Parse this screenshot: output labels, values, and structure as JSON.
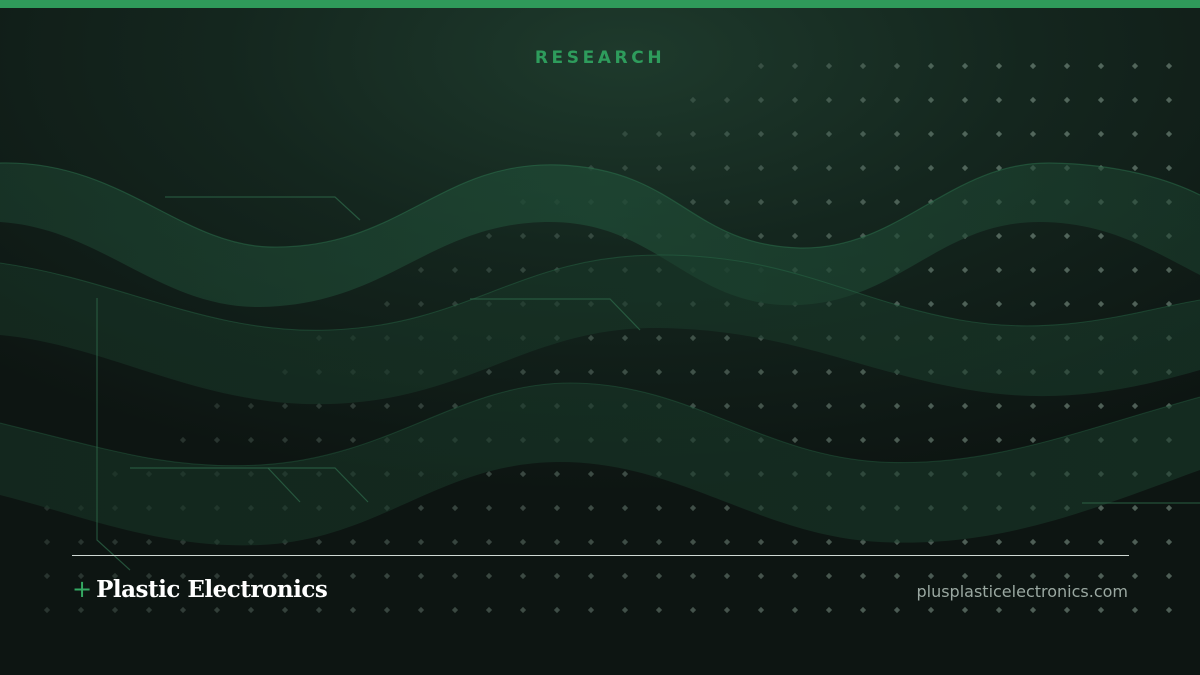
{
  "header": {
    "category": "RESEARCH"
  },
  "footer": {
    "brand_plus": "+",
    "brand_name": "Plastic Electronics",
    "website": "plusplasticelectronics.com"
  },
  "colors": {
    "accent_green": "#2f9a5a",
    "background_dark": "#0f1a16",
    "wave_fill": "#1a3a2a",
    "divider": "#cfd8d3",
    "url_gray": "#9aa8a1"
  },
  "decoration": {
    "background_art": "flowing-waves-with-circuit-traces-and-dot-grid"
  }
}
